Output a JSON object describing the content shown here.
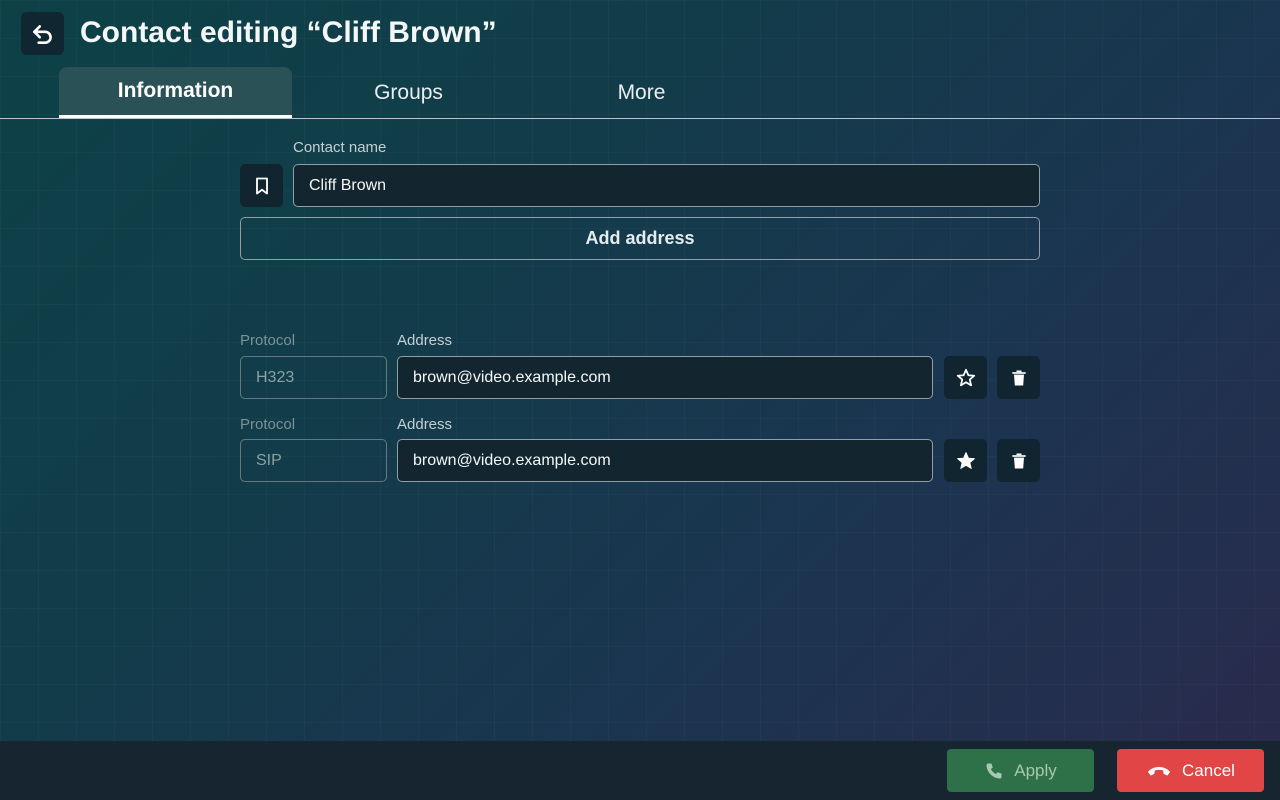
{
  "header": {
    "title": "Contact editing “Cliff Brown”",
    "back_icon": "undo-arrow-icon"
  },
  "tabs": [
    {
      "label": "Information",
      "active": true
    },
    {
      "label": "Groups",
      "active": false
    },
    {
      "label": "More",
      "active": false
    }
  ],
  "contact": {
    "name_label": "Contact name",
    "name_value": "Cliff Brown",
    "bookmark_icon": "bookmark-icon"
  },
  "add_address_label": "Add address",
  "addresses": [
    {
      "protocol_label": "Protocol",
      "protocol": "H323",
      "address_label": "Address",
      "address": "brown@video.example.com",
      "favorite": false
    },
    {
      "protocol_label": "Protocol",
      "protocol": "SIP",
      "address_label": "Address",
      "address": "brown@video.example.com",
      "favorite": true
    }
  ],
  "footer": {
    "apply_label": "Apply",
    "cancel_label": "Cancel"
  },
  "colors": {
    "apply": "#2e7048",
    "cancel": "#e14545",
    "accent_tab": "#2a5156"
  }
}
